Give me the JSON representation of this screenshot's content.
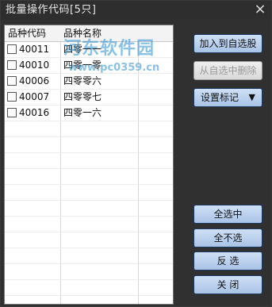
{
  "window": {
    "title": "批量操作代码[5只]"
  },
  "table": {
    "headers": {
      "code": "品种代码",
      "name": "品种名称"
    },
    "rows": [
      {
        "code": "40011",
        "name": "四零一一"
      },
      {
        "code": "40010",
        "name": "四零一零"
      },
      {
        "code": "40006",
        "name": "四零零六"
      },
      {
        "code": "40007",
        "name": "四零零七"
      },
      {
        "code": "40016",
        "name": "四零一六"
      }
    ]
  },
  "buttons": {
    "add_to_watchlist": "加入到自选股",
    "remove_from_watchlist": "从自选中删除",
    "set_mark": "设置标记",
    "select_all": "全选中",
    "select_none": "全不选",
    "invert_selection": "反 选",
    "close": "关 闭"
  },
  "watermark": {
    "line1": "河东软件园",
    "line2": "www.pc0359.cn"
  },
  "icons": {
    "close": "close-icon",
    "dropdown": "triangle-down-icon"
  }
}
